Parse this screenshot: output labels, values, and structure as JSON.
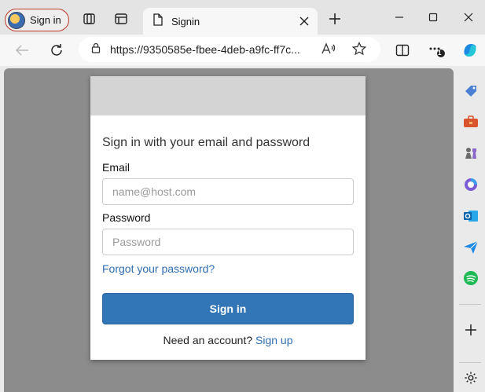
{
  "titlebar": {
    "profile_label": "Sign in",
    "tab_title": "Signin",
    "icons": [
      "workspaces-icon",
      "vertical-tabs-icon",
      "page-icon",
      "close-icon",
      "new-tab-icon",
      "minimize-icon",
      "maximize-icon",
      "window-close-icon"
    ]
  },
  "navbar": {
    "url": "https://9350585e-fbee-4deb-a9fc-ff7c...",
    "icons": [
      "back-icon",
      "refresh-icon",
      "lock-icon",
      "read-aloud-icon",
      "favorite-star-icon",
      "split-screen-icon",
      "more-icon",
      "copilot-icon"
    ],
    "notification_count": "1"
  },
  "form": {
    "heading": "Sign in with your email and password",
    "email_label": "Email",
    "email_placeholder": "name@host.com",
    "password_label": "Password",
    "password_placeholder": "Password",
    "forgot_link": "Forgot your password?",
    "submit_label": "Sign in",
    "signup_prompt": "Need an account?",
    "signup_link": "Sign up"
  },
  "sidebar": {
    "icons": [
      "tag-icon",
      "toolbox-icon",
      "chess-icon",
      "microsoft365-icon",
      "outlook-icon",
      "send-icon",
      "spotify-icon",
      "add-icon",
      "settings-icon"
    ]
  },
  "colors": {
    "accent": "#3376b7",
    "link": "#2f6fb3",
    "viewport_bg": "#8c8c8c"
  }
}
